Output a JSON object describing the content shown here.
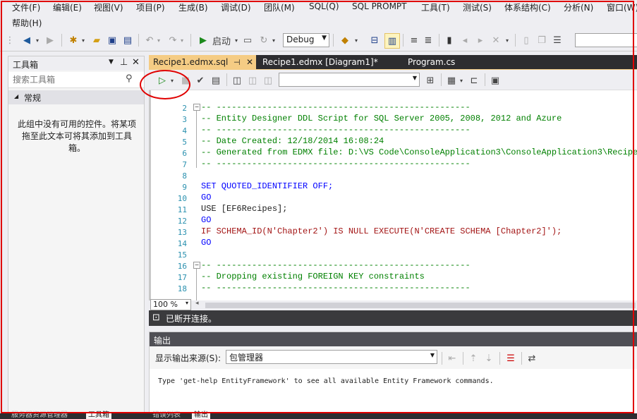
{
  "menu": {
    "items": [
      "文件(F)",
      "编辑(E)",
      "视图(V)",
      "项目(P)",
      "生成(B)",
      "调试(D)",
      "团队(M)",
      "SQL(Q)",
      "SQL PROMPT",
      "工具(T)",
      "测试(S)",
      "体系结构(C)",
      "分析(N)",
      "窗口(W)"
    ],
    "help": "帮助(H)"
  },
  "toolbar": {
    "start_label": "启动",
    "config_value": "Debug"
  },
  "toolbox": {
    "title": "工具箱",
    "search_placeholder": "搜索工具箱",
    "group": "常规",
    "empty_message": "此组中没有可用的控件。将某项拖至此文本可将其添加到工具箱。"
  },
  "tabs": [
    {
      "label": "Recipe1.edmx.sql"
    },
    {
      "label": "Recipe1.edmx [Diagram1]*"
    },
    {
      "label": "Program.cs"
    }
  ],
  "code": {
    "lines": [
      {
        "n": "2",
        "text": "-- --------------------------------------------------"
      },
      {
        "n": "3",
        "text": "-- Entity Designer DDL Script for SQL Server 2005, 2008, 2012 and Azure"
      },
      {
        "n": "4",
        "text": "-- --------------------------------------------------"
      },
      {
        "n": "5",
        "text": "-- Date Created: 12/18/2014 16:08:24"
      },
      {
        "n": "6",
        "text": "-- Generated from EDMX file: D:\\VS Code\\ConsoleApplication3\\ConsoleApplication3\\Recipe1."
      },
      {
        "n": "7",
        "text": "-- --------------------------------------------------"
      },
      {
        "n": "8",
        "text": ""
      },
      {
        "n": "9",
        "text": "SET QUOTED_IDENTIFIER OFF;"
      },
      {
        "n": "10",
        "text": "GO"
      },
      {
        "n": "11",
        "text": "USE [EF6Recipes];"
      },
      {
        "n": "12",
        "text": "GO"
      },
      {
        "n": "13",
        "text": "IF SCHEMA_ID(N'Chapter2') IS NULL EXECUTE(N'CREATE SCHEMA [Chapter2]');"
      },
      {
        "n": "14",
        "text": "GO"
      },
      {
        "n": "15",
        "text": ""
      },
      {
        "n": "16",
        "text": "-- --------------------------------------------------"
      },
      {
        "n": "17",
        "text": "-- Dropping existing FOREIGN KEY constraints"
      },
      {
        "n": "18",
        "text": "-- --------------------------------------------------"
      }
    ]
  },
  "zoom": "100 %",
  "status": "已断开连接。",
  "output": {
    "title": "输出",
    "source_label": "显示输出来源(S):",
    "source_value": "包管理器",
    "message": "Type 'get-help EntityFramework' to see all available Entity Framework commands."
  },
  "bottom_tabs": {
    "left": [
      "服务器资源管理器",
      "工具箱"
    ],
    "right": [
      "错误列表",
      "输出"
    ]
  },
  "colors": {
    "accent": "#007acc",
    "tab_active": "#f5cc84",
    "comment": "#008000",
    "keyword": "#0000ff",
    "function": "#ff00ff",
    "string": "#a31515",
    "annotation_red": "#e00000"
  }
}
